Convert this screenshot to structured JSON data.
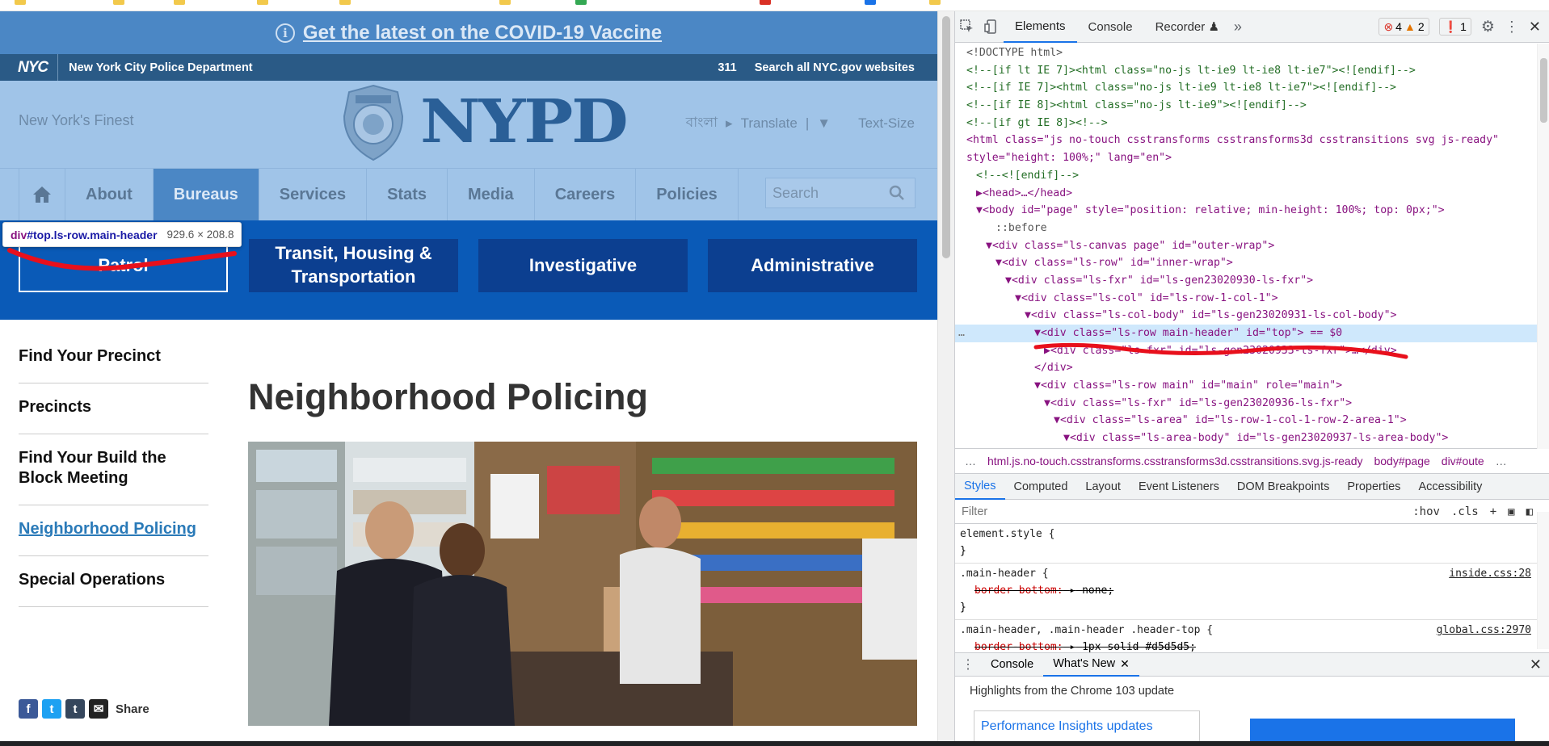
{
  "covid": {
    "text": "Get the latest on the COVID-19 Vaccine"
  },
  "nycbar": {
    "logo": "NYC",
    "department": "New York City Police Department",
    "link_311": "311",
    "search_all": "Search all NYC.gov websites"
  },
  "header": {
    "tagline": "New York's Finest",
    "brand": "NYPD",
    "lang_bangla": "বাংলা",
    "translate": "Translate",
    "text_size": "Text-Size"
  },
  "nav": {
    "items": [
      "About",
      "Bureaus",
      "Services",
      "Stats",
      "Media",
      "Careers",
      "Policies"
    ],
    "active": "Bureaus",
    "search_placeholder": "Search"
  },
  "bureaus": {
    "buttons": [
      "Patrol",
      "Transit, Housing & Transportation",
      "Investigative",
      "Administrative"
    ]
  },
  "inspect_tooltip": {
    "selector_tag": "div",
    "selector_rest": "#top.ls-row.main-header",
    "dimensions": "929.6 × 208.8"
  },
  "sidebar": {
    "links": [
      "Find Your Precinct",
      "Precincts",
      "Find Your Build the Block Meeting",
      "Neighborhood Policing",
      "Special Operations"
    ],
    "current": "Neighborhood Policing",
    "share_label": "Share"
  },
  "content": {
    "title": "Neighborhood Policing"
  },
  "devtools": {
    "tabs": [
      "Elements",
      "Console",
      "Recorder"
    ],
    "active_tab": "Elements",
    "errors": "4",
    "warnings": "2",
    "issues": "1",
    "dom_lines": [
      "<!DOCTYPE html>",
      "<!--[if lt IE 7]><html class=\"no-js lt-ie9 lt-ie8 lt-ie7\"><![endif]-->",
      "<!--[if IE 7]><html class=\"no-js lt-ie9 lt-ie8 lt-ie7\"><![endif]-->",
      "<!--[if IE 8]><html class=\"no-js lt-ie9\"><![endif]-->",
      "<!--[if gt IE 8]><!-->",
      "<html class=\"js no-touch csstransforms csstransforms3d csstransitions svg js-ready\"",
      "style=\"height: 100%;\" lang=\"en\">",
      "<!--<![endif]-->",
      "▶<head>…</head>",
      "▼<body id=\"page\" style=\"position: relative; min-height: 100%; top: 0px;\">",
      "::before",
      "▼<div class=\"ls-canvas page\" id=\"outer-wrap\">",
      "▼<div class=\"ls-row\" id=\"inner-wrap\">",
      "▼<div class=\"ls-fxr\" id=\"ls-gen23020930-ls-fxr\">",
      "▼<div class=\"ls-col\" id=\"ls-row-1-col-1\">",
      "▼<div class=\"ls-col-body\" id=\"ls-gen23020931-ls-col-body\">",
      "▼<div class=\"ls-row main-header\" id=\"top\"> == $0",
      "▶<div class=\"ls-fxr\" id=\"ls-gen23020933-ls-fxr\">…</div>",
      "</div>",
      "▼<div class=\"ls-row main\" id=\"main\" role=\"main\">",
      "▼<div class=\"ls-fxr\" id=\"ls-gen23020936-ls-fxr\">",
      "▼<div class=\"ls-area\" id=\"ls-row-1-col-1-row-2-area-1\">",
      "▼<div class=\"ls-area-body\" id=\"ls-gen23020937-ls-area-body\">"
    ],
    "breadcrumbs": [
      "…",
      "html.js.no-touch.csstransforms.csstransforms3d.csstransitions.svg.js-ready",
      "body#page",
      "div#oute",
      "…"
    ],
    "style_tabs": [
      "Styles",
      "Computed",
      "Layout",
      "Event Listeners",
      "DOM Breakpoints",
      "Properties",
      "Accessibility"
    ],
    "active_style_tab": "Styles",
    "filter_placeholder": "Filter",
    "hov": ":hov",
    "cls": ".cls",
    "rules": [
      {
        "selector": "element.style {",
        "props": [],
        "close": "}",
        "source": ""
      },
      {
        "selector": ".main-header {",
        "props": [
          {
            "name": "border-bottom:",
            "value": "none;"
          }
        ],
        "close": "}",
        "source": "inside.css:28"
      },
      {
        "selector": ".main-header, .main-header .header-top {",
        "props": [
          {
            "name": "border-bottom:",
            "value": "1px solid #d5d5d5;"
          }
        ],
        "close": "",
        "source": "global.css:2970"
      }
    ],
    "drawer_tabs": [
      "Console",
      "What's New"
    ],
    "active_drawer_tab": "What's New",
    "whats_new_heading": "Highlights from the Chrome 103 update",
    "card_title": "Performance Insights updates"
  }
}
